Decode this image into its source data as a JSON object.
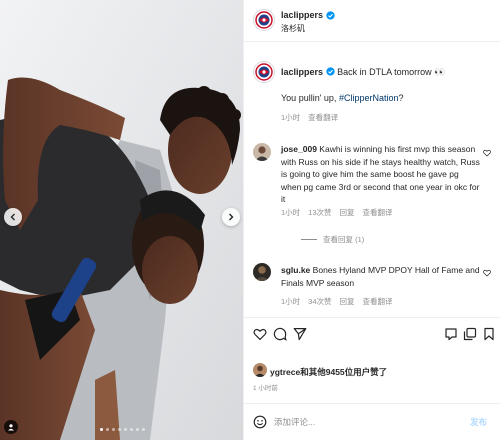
{
  "account": {
    "username": "laclippers",
    "location": "洛杉矶"
  },
  "caption": {
    "username": "laclippers",
    "text": "Back in DTLA tomorrow 👀",
    "line2_prefix": "You pullin' up, ",
    "hashtag": "#ClipperNation",
    "line2_suffix": "?",
    "time": "1小时",
    "translate": "查看翻译"
  },
  "comments": [
    {
      "username": "jose_009",
      "text": "Kawhi is winning his first mvp this season with Russ on his side if he stays healthy watch, Russ is going to give him the same boost he gave pg when pg came 3rd or second that one year in okc for it",
      "time": "1小时",
      "likes": "13次赞",
      "reply": "回复",
      "translate": "查看翻译",
      "view_replies": "查看回复 (1)"
    },
    {
      "username": "sglu.ke",
      "text": "Bones Hyland MVP DPOY Hall of Fame and Finals MVP season",
      "time": "1小时",
      "likes": "34次赞",
      "reply": "回复",
      "translate": "查看翻译"
    }
  ],
  "likes": {
    "user": "ygtrece",
    "text": "和其他9455位用户赞了"
  },
  "post_time": "1 小时前",
  "comment_box": {
    "placeholder": "添加评论...",
    "post_label": "发布"
  },
  "icons": {
    "verified": "verified-badge-icon",
    "like": "heart-icon",
    "comment": "comment-icon",
    "share": "send-icon",
    "save": "bookmark-icon",
    "emoji": "emoji-icon"
  },
  "colors": {
    "accent": "#0095f6",
    "hashtag": "#00376b",
    "muted": "#8e8e8e",
    "clippers_red": "#c8102e",
    "clippers_blue": "#1d428a"
  },
  "carousel": {
    "slide_count": 8,
    "active_slide": 1
  }
}
